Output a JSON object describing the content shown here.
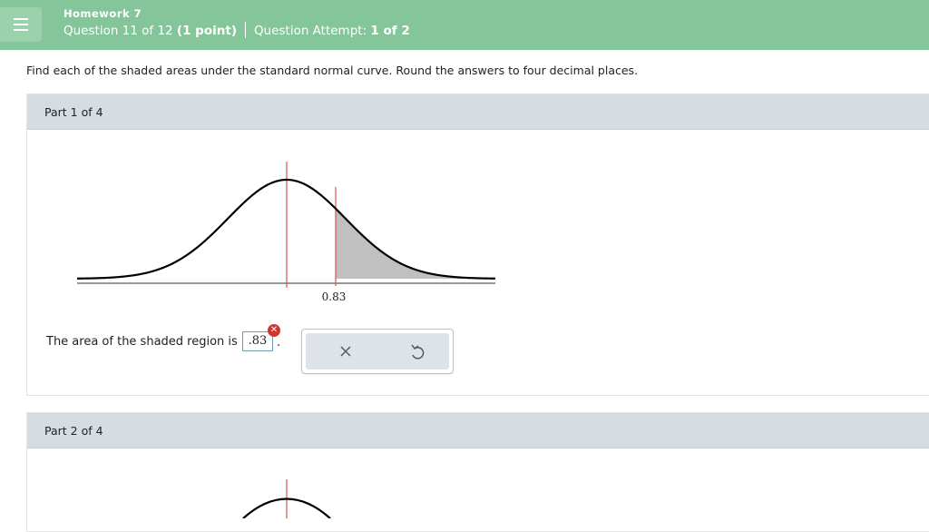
{
  "header": {
    "homework_title": "Homework 7",
    "question_prefix": "Question 11 of 12",
    "question_points": "(1 point)",
    "attempt_prefix": "Question Attempt:",
    "attempt_value": "1 of 2"
  },
  "instructions": "Find each of the shaded areas under the standard normal curve. Round the answers to four decimal places.",
  "part1": {
    "label": "Part 1 of 4",
    "figure": {
      "z_value": "0.83",
      "shaded_region": "right tail"
    },
    "answer_prompt": "The area of the shaded region is",
    "answer_value": ".83",
    "answer_suffix": ".",
    "answer_status": "incorrect"
  },
  "part2": {
    "label": "Part 2 of 4"
  },
  "toolbar": {
    "clear_icon": "close-x-icon",
    "undo_icon": "undo-icon"
  },
  "colors": {
    "header_green": "#85c59a",
    "part_header_gray": "#d6dde2",
    "error_red": "#d3352f",
    "curve_red_line": "#d9534f",
    "shade_gray": "#c0c0c0"
  }
}
